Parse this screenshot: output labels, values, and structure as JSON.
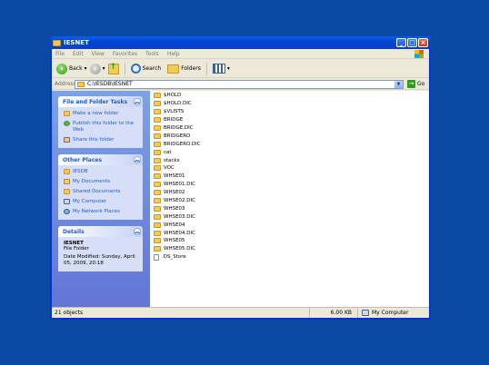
{
  "window": {
    "title": "IESNET"
  },
  "menu": [
    "File",
    "Edit",
    "View",
    "Favorites",
    "Tools",
    "Help"
  ],
  "toolbar": {
    "back": "Back",
    "search": "Search",
    "folders": "Folders"
  },
  "address": {
    "label": "Address",
    "value": "C:\\IESDB\\IESNET",
    "go": "Go"
  },
  "tasks": {
    "title": "File and Folder Tasks",
    "items": [
      "Make a new folder",
      "Publish this folder to the Web",
      "Share this folder"
    ]
  },
  "places": {
    "title": "Other Places",
    "items": [
      "IESDB",
      "My Documents",
      "Shared Documents",
      "My Computer",
      "My Network Places"
    ]
  },
  "details": {
    "title": "Details",
    "name": "IESNET",
    "type": "File Folder",
    "modified": "Date Modified: Sunday, April 05, 2009, 20:18"
  },
  "files": [
    {
      "name": "$HOLD",
      "kind": "folder"
    },
    {
      "name": "$HOLD.DIC",
      "kind": "folder"
    },
    {
      "name": "$VLISTS",
      "kind": "folder"
    },
    {
      "name": "BRIDGE",
      "kind": "folder"
    },
    {
      "name": "BRIDGE.DIC",
      "kind": "folder"
    },
    {
      "name": "BRIDGERO",
      "kind": "folder"
    },
    {
      "name": "BRIDGERO.DIC",
      "kind": "folder"
    },
    {
      "name": "cat",
      "kind": "folder"
    },
    {
      "name": "stacks",
      "kind": "folder"
    },
    {
      "name": "VOC",
      "kind": "folder"
    },
    {
      "name": "WHSE01",
      "kind": "folder"
    },
    {
      "name": "WHSE01.DIC",
      "kind": "folder"
    },
    {
      "name": "WHSE02",
      "kind": "folder"
    },
    {
      "name": "WHSE02.DIC",
      "kind": "folder"
    },
    {
      "name": "WHSE03",
      "kind": "folder"
    },
    {
      "name": "WHSE03.DIC",
      "kind": "folder"
    },
    {
      "name": "WHSE04",
      "kind": "folder"
    },
    {
      "name": "WHSE04.DIC",
      "kind": "folder"
    },
    {
      "name": "WHSE05",
      "kind": "folder"
    },
    {
      "name": "WHSE05.DIC",
      "kind": "folder"
    },
    {
      "name": ".DS_Store",
      "kind": "file"
    }
  ],
  "status": {
    "count": "21 objects",
    "size": "6.00 KB",
    "location": "My Computer"
  }
}
